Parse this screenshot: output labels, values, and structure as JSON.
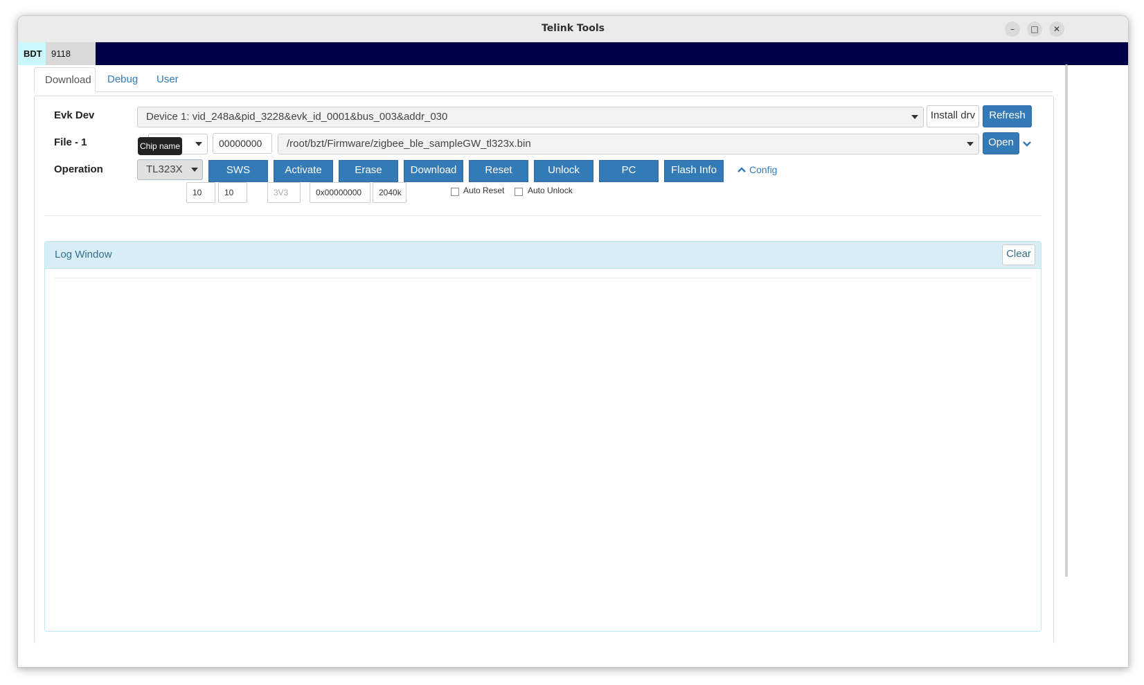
{
  "window": {
    "title": "Telink Tools",
    "minimize_glyph": "–",
    "maximize_glyph": "□",
    "close_glyph": "✕"
  },
  "app_tabs": [
    {
      "label": "BDT",
      "active": true
    },
    {
      "label": "9118 BDT",
      "active": false
    }
  ],
  "tabs": [
    {
      "label": "Download",
      "active": true
    },
    {
      "label": "Debug",
      "active": false
    },
    {
      "label": "User",
      "active": false
    }
  ],
  "evk": {
    "label": "Evk Dev",
    "device": "Device 1: vid_248a&pid_3228&evk_id_0001&bus_003&addr_030",
    "install_label": "Install drv",
    "refresh_label": "Refresh"
  },
  "file": {
    "label": "File - 1",
    "tooltip": "Chip name",
    "address": "00000000",
    "path": "/root/bzt/Firmware/zigbee_ble_sampleGW_tl323x.bin",
    "open_label": "Open"
  },
  "operation": {
    "label": "Operation",
    "chip": "TL323X",
    "buttons": [
      "SWS",
      "Activate",
      "Erase",
      "Download",
      "Reset",
      "Unlock",
      "PC",
      "Flash Info"
    ],
    "config_label": "Config",
    "params": {
      "p1": "10",
      "p2": "10",
      "voltage": "3V3",
      "addr": "0x00000000",
      "size": "2040k"
    },
    "auto_reset_label": "Auto Reset",
    "auto_unlock_label": "Auto Unlock"
  },
  "log": {
    "title": "Log Window",
    "clear_label": "Clear"
  },
  "colors": {
    "primary": "#337ab7",
    "nav_bg": "#000046",
    "active_app_tab": "#c9f7fb",
    "log_heading": "#d9edf7"
  }
}
